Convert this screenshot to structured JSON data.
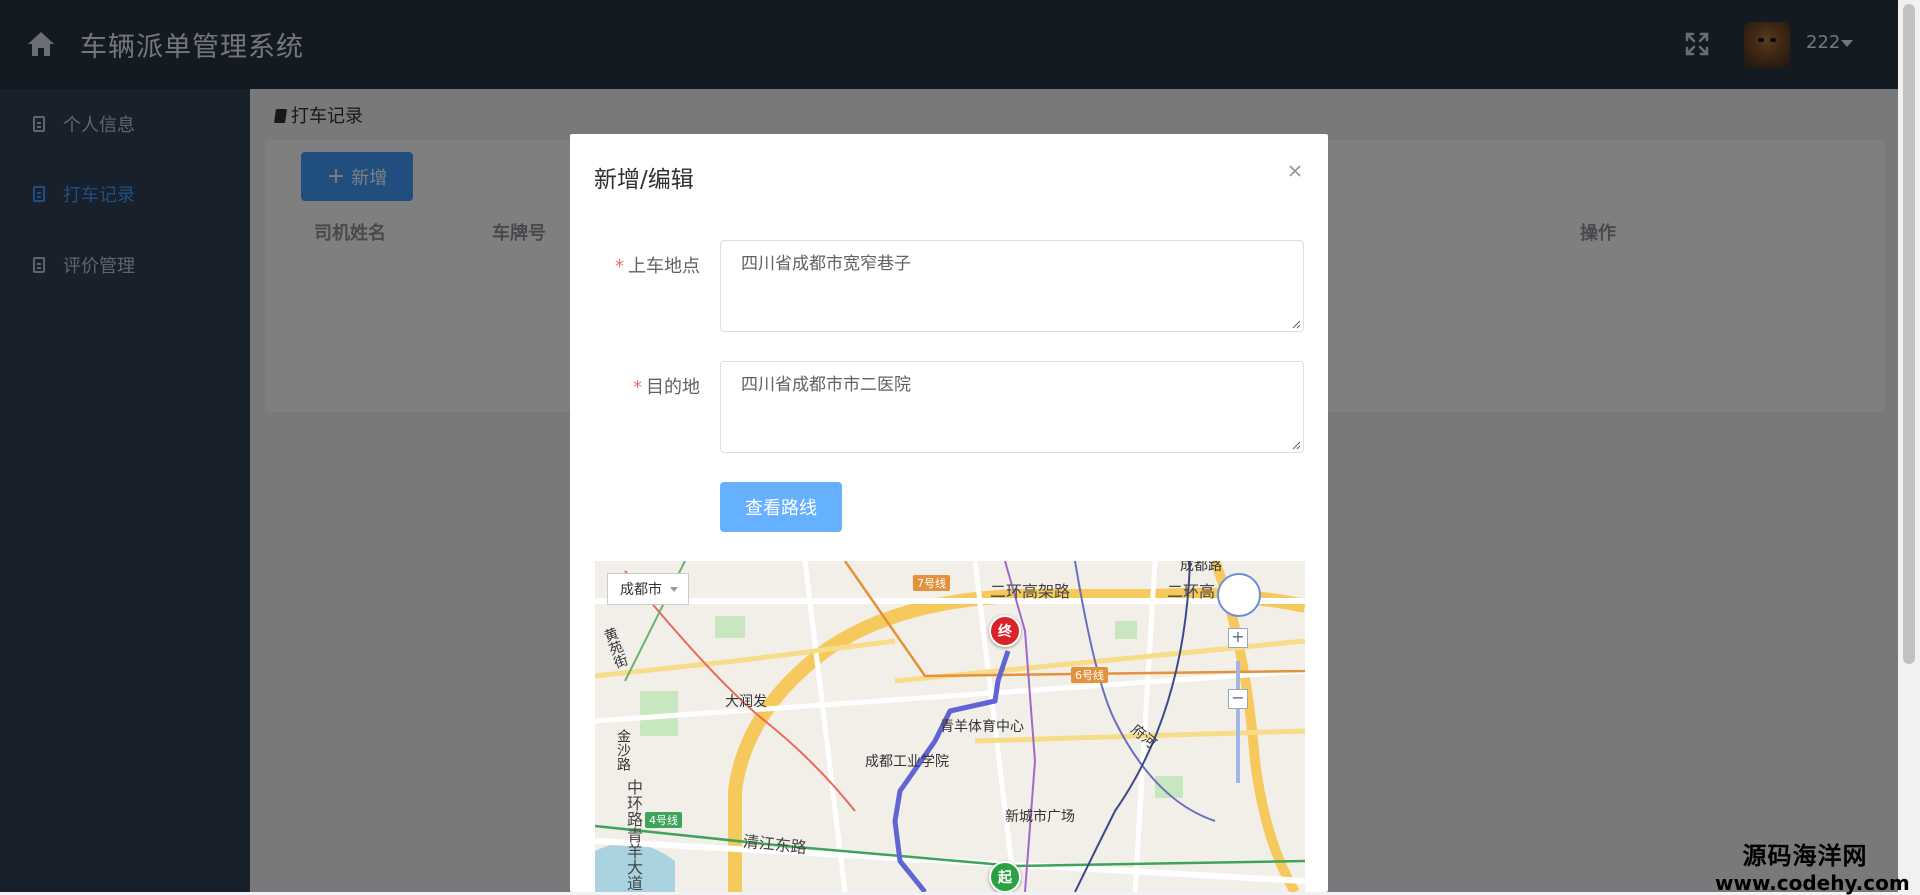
{
  "header": {
    "title": "车辆派单管理系统",
    "username": "222",
    "icons": [
      "home-icon",
      "fullscreen-icon",
      "caret-down-icon"
    ]
  },
  "sidebar": {
    "items": [
      {
        "label": "个人信息",
        "active": false
      },
      {
        "label": "打车记录",
        "active": true
      },
      {
        "label": "评价管理",
        "active": false
      }
    ]
  },
  "breadcrumb": {
    "label": "打车记录"
  },
  "toolbar": {
    "add_label": "新增"
  },
  "table": {
    "columns": [
      "司机姓名",
      "车牌号",
      "操作"
    ]
  },
  "dialog": {
    "title": "新增/编辑",
    "pickup": {
      "label": "上车地点",
      "value": "四川省成都市宽窄巷子"
    },
    "destination": {
      "label": "目的地",
      "value": "四川省成都市市二医院"
    },
    "route_button": "查看路线",
    "map": {
      "city": "成都市",
      "labels": {
        "erhuan_road": "二环高架路",
        "erhuan_short": "二环高",
        "chengdu_road": "成都路",
        "line7": "7号线",
        "line6": "6号线",
        "line4": "4号线",
        "huangyuan": "黄苑街",
        "darunfa": "大润发",
        "qingyang_stadium": "青羊体育中心",
        "chengdu_tech": "成都工业学院",
        "xincheng_plaza": "新城市广场",
        "fuhe": "府河",
        "jinsha_road": "金沙路",
        "zhonghuan": "中环路青羊大道",
        "qingjiang_east": "清江东路"
      },
      "start_marker": "起",
      "end_marker": "终"
    }
  },
  "watermark": {
    "name": "源码海洋网",
    "url": "www.codehy.com"
  },
  "colors": {
    "header": "#263445",
    "sidebar": "#304156",
    "primary": "#409eff",
    "active_menu": "#409eff",
    "required": "#f56c6c"
  }
}
